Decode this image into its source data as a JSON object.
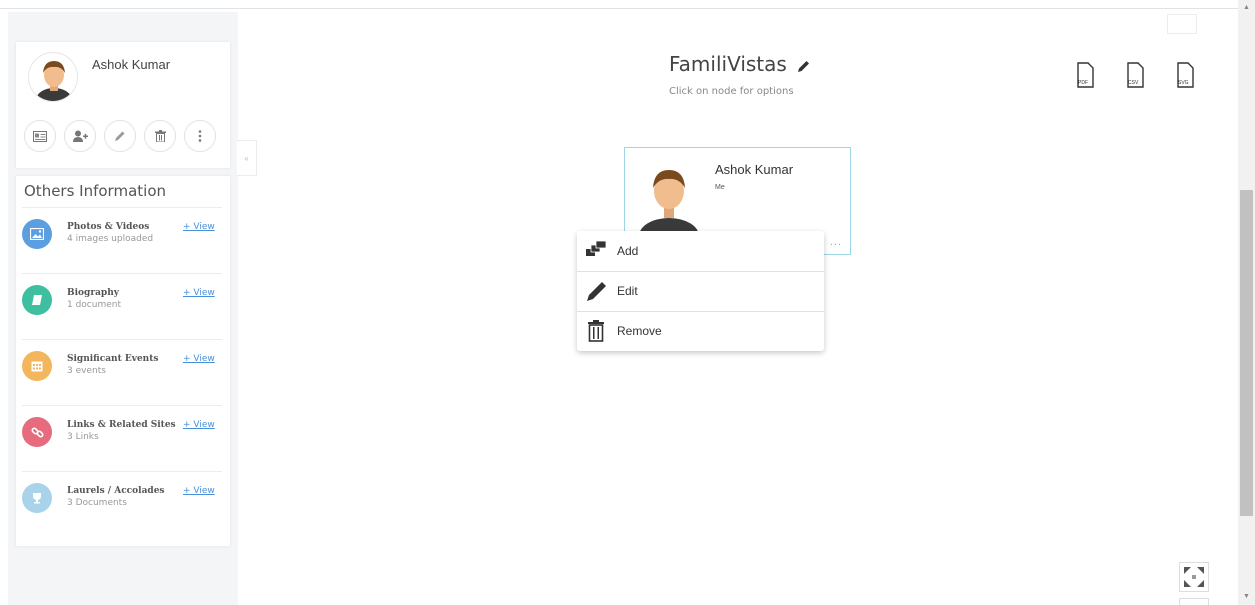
{
  "app": {
    "title": "FamiliVistas",
    "subtitle": "Click on node for options"
  },
  "profile": {
    "name": "Ashok Kumar",
    "actions": [
      "contact-card",
      "add-person",
      "edit",
      "delete",
      "more"
    ]
  },
  "others": {
    "title": "Others Information",
    "items": [
      {
        "name": "Photos & Videos",
        "sub": "4 images uploaded",
        "view": "+ View",
        "color": "#5b9fe0",
        "icon": "image-icon"
      },
      {
        "name": "Biography",
        "sub": "1 document",
        "view": "+ View",
        "color": "#3dbfa0",
        "icon": "book-icon"
      },
      {
        "name": "Significant Events",
        "sub": "3 events",
        "view": "+ View",
        "color": "#f2b65c",
        "icon": "calendar-icon"
      },
      {
        "name": "Links & Related Sites",
        "sub": "3 Links",
        "view": "+ View",
        "color": "#e56b7d",
        "icon": "link-icon"
      },
      {
        "name": "Laurels / Accolades",
        "sub": "3 Documents",
        "view": "+ View",
        "color": "#a9d3e9",
        "icon": "trophy-icon"
      }
    ]
  },
  "exports": [
    "PDF",
    "CSV",
    "SVG"
  ],
  "node": {
    "name": "Ashok Kumar",
    "relation": "Me",
    "more": "..."
  },
  "context_menu": {
    "items": [
      {
        "label": "Add",
        "icon": "add-node-icon"
      },
      {
        "label": "Edit",
        "icon": "pencil-icon"
      },
      {
        "label": "Remove",
        "icon": "trash-icon"
      }
    ]
  },
  "colors": {
    "accent": "#4a90d9",
    "node_border": "#9fd3e6"
  }
}
